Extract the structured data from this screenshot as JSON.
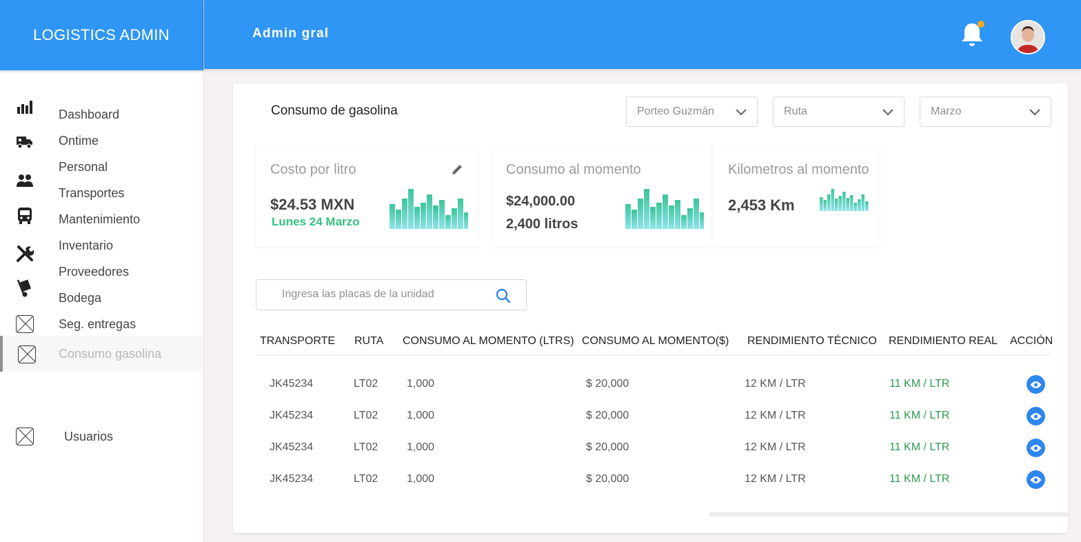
{
  "app": {
    "brand": "LOGISTICS ADMIN",
    "header_title": "Admin gral"
  },
  "sidebar": {
    "items": [
      {
        "label": "Dashboard",
        "icon": "bar-chart-icon"
      },
      {
        "label": "Ontime",
        "icon": "truck-icon"
      },
      {
        "label": "Personal",
        "icon": "people-icon"
      },
      {
        "label": "Transportes",
        "icon": "bus-icon"
      },
      {
        "label": "Mantenimiento",
        "icon": "tools-icon"
      },
      {
        "label": "Inventario",
        "icon": "placeholder-icon"
      },
      {
        "label": "Proveedores",
        "icon": "placeholder-icon"
      },
      {
        "label": "Bodega",
        "icon": "hand-truck-icon"
      },
      {
        "label": "Seg. entregas",
        "icon": "placeholder-icon"
      },
      {
        "label": "Consumo gasolina",
        "icon": "placeholder-icon",
        "active": true
      },
      {
        "label": "Usuarios",
        "icon": "placeholder-icon"
      }
    ]
  },
  "card": {
    "title": "Consumo de gasolina",
    "filters": [
      {
        "value": "Porteo Guzmán"
      },
      {
        "value": "Ruta"
      },
      {
        "value": "Marzo"
      }
    ],
    "stats": {
      "cost": {
        "label": "Costo por litro",
        "value": "$24.53 MXN",
        "date": "Lunes 24 Marzo"
      },
      "consumption": {
        "label": "Consumo al momento",
        "amount": "$24,000.00",
        "liters": "2,400 litros"
      },
      "km": {
        "label": "Kilometros al momento",
        "value": "2,453 Km"
      }
    },
    "search": {
      "placeholder": "Ingresa las placas de la unidad"
    },
    "table": {
      "headers": [
        "TRANSPORTE",
        "RUTA",
        "CONSUMO AL MOMENTO (LTRS)",
        "CONSUMO AL MOMENTO($)",
        "RENDIMIENTO TÉCNICO",
        "RENDIMIENTO REAL",
        "ACCIÓN"
      ],
      "rows": [
        [
          "JK45234",
          "LT02",
          "1,000",
          "$ 20,000",
          "12 KM / LTR",
          "11 KM / LTR"
        ],
        [
          "JK45234",
          "LT02",
          "1,000",
          "$ 20,000",
          "12 KM / LTR",
          "11 KM / LTR"
        ],
        [
          "JK45234",
          "LT02",
          "1,000",
          "$ 20,000",
          "12 KM / LTR",
          "11 KM / LTR"
        ],
        [
          "JK45234",
          "LT02",
          "1,000",
          "$ 20,000",
          "12 KM / LTR",
          "11 KM / LTR"
        ]
      ]
    }
  },
  "colors": {
    "primary": "#2f96f5",
    "accent_green": "#34c27d",
    "real_green": "#2c9b4d",
    "bar_teal": "#5fd0c0"
  }
}
